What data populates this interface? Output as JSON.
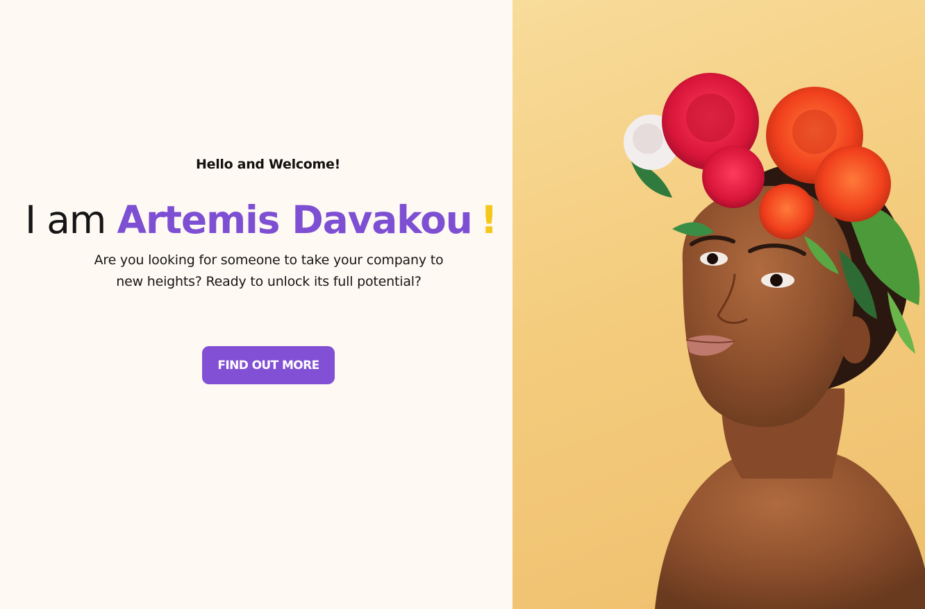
{
  "hero": {
    "greeting": "Hello and Welcome!",
    "headline_prefix": "I am ",
    "headline_name": "Artemis Davakou",
    "headline_suffix": "!",
    "intro_line_1": "Are you looking for someone to take your company to",
    "intro_line_2": "new heights? Ready to unlock its full potential?",
    "cta_label": "FIND OUT MORE"
  },
  "portrait": {
    "subject": "woman-wearing-flower-crown"
  },
  "colors": {
    "background": "#fff9f3",
    "accent_purple": "#7d4fd3",
    "button_purple": "#8250d4",
    "exclamation_yellow": "#f4c71b",
    "photo_backdrop": "#f4cc7e",
    "text_dark": "#151515"
  }
}
